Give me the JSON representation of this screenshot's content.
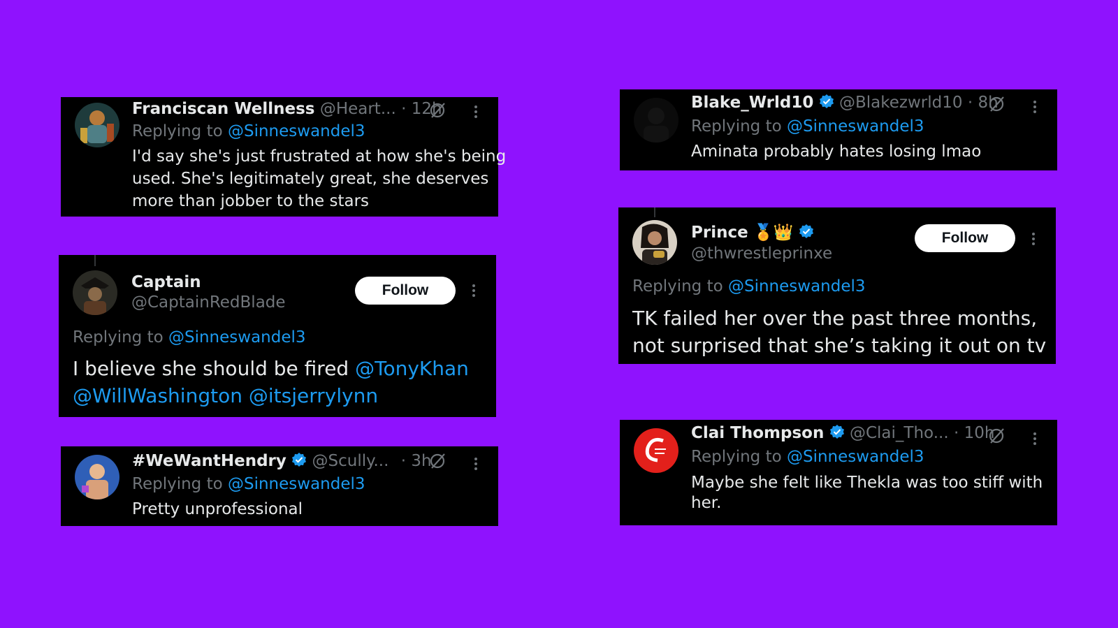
{
  "colors": {
    "background": "#8f12fe",
    "card": "#000000",
    "text": "#e7e9ea",
    "muted": "#71767b",
    "link": "#1d9bf0",
    "follow_bg": "#ffffff"
  },
  "tweets": [
    {
      "name": "Franciscan Wellness",
      "handle": "@Heart...",
      "time": "· 12h",
      "replying_prefix": "Replying to",
      "replying_to": "@Sinneswandel3",
      "text_lines": [
        "I'd say she's just frustrated at how she's being",
        "used. She's legitimately great, she deserves",
        "more than jobber to the stars"
      ],
      "avatar_icon": "avatar-armor-figure",
      "verified": false
    },
    {
      "name": "Captain",
      "handle": "@CaptainRedBlade",
      "follow_label": "Follow",
      "replying_prefix": "Replying to",
      "replying_to": "@Sinneswandel3",
      "text_plain": "I believe she should be fired",
      "mentions": [
        "@TonyKhan",
        "@WillWashington",
        "@itsjerrylynn"
      ],
      "avatar_icon": "avatar-pirate",
      "verified": false
    },
    {
      "name": "#WeWantHendry",
      "handle": "@Scully...",
      "time": "· 3h",
      "replying_prefix": "Replying to",
      "replying_to": "@Sinneswandel3",
      "text": "Pretty unprofessional",
      "avatar_icon": "avatar-wrestler",
      "verified": true
    },
    {
      "name": "Blake_Wrld10",
      "handle": "@Blakezwrld10",
      "time": "· 8h",
      "replying_prefix": "Replying to",
      "replying_to": "@Sinneswandel3",
      "text": "Aminata probably hates losing lmao",
      "avatar_icon": "avatar-dark",
      "verified": true
    },
    {
      "name": "Prince",
      "name_emoji": "🏅👑",
      "handle": "@thwrestleprinxe",
      "follow_label": "Follow",
      "replying_prefix": "Replying to",
      "replying_to": "@Sinneswandel3",
      "text_lines": [
        "TK failed her over the past three months,",
        "not surprised that she’s taking it out on tv"
      ],
      "avatar_icon": "avatar-belt-holder",
      "verified": true
    },
    {
      "name": "Clai Thompson",
      "handle": "@Clai_Tho...",
      "time": "· 10h",
      "replying_prefix": "Replying to",
      "replying_to": "@Sinneswandel3",
      "text_lines": [
        "Maybe she felt like Thekla was too stiff with",
        "her."
      ],
      "avatar_icon": "avatar-red-logo",
      "verified": true
    }
  ]
}
